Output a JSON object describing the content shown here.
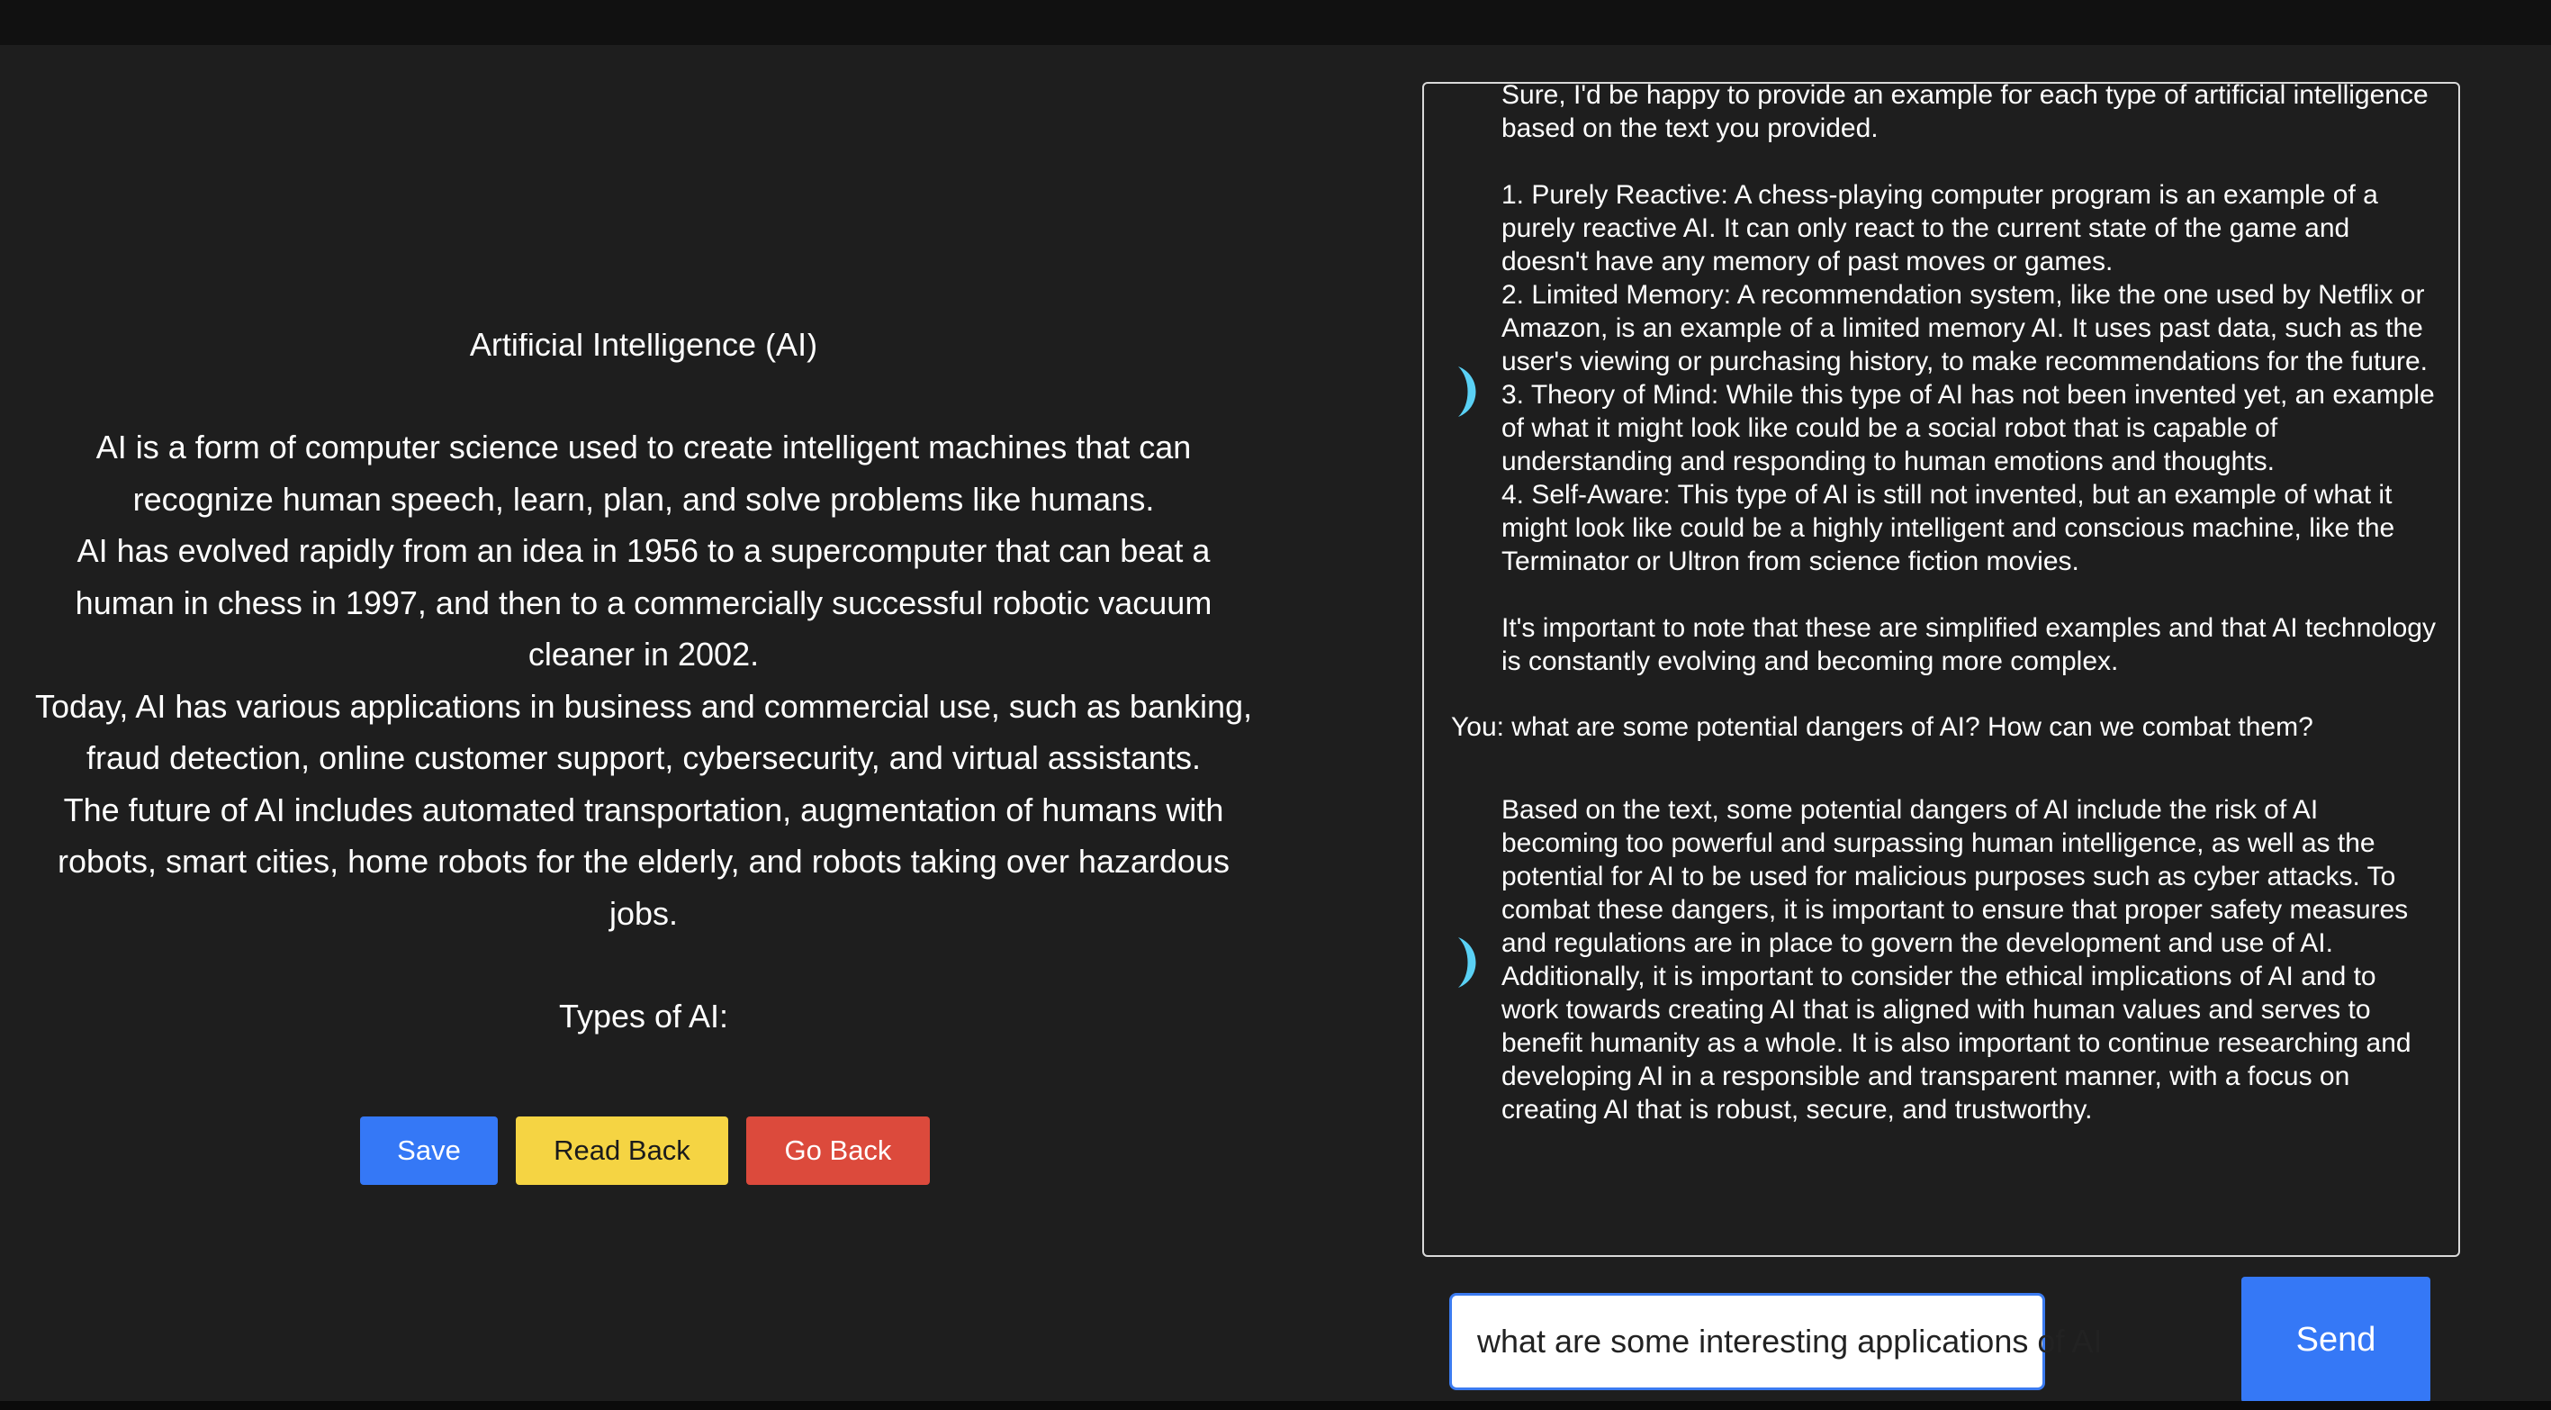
{
  "document": {
    "heading": "Artificial Intelligence (AI)",
    "paragraphs": [
      "AI is a form of computer science used to create intelligent machines that can recognize human speech, learn, plan, and solve problems like humans.",
      "AI has evolved rapidly from an idea in 1956 to a supercomputer that can beat a human in chess in 1997, and then to a commercially successful robotic vacuum cleaner in 2002.",
      "Today, AI has various applications in business and commercial use, such as banking, fraud detection, online customer support, cybersecurity, and virtual assistants.",
      "The future of AI includes automated transportation, augmentation of humans with robots, smart cities, home robots for the elderly, and robots taking over hazardous jobs."
    ],
    "next_heading": "Types of AI:"
  },
  "buttons": {
    "save": "Save",
    "read_back": "Read Back",
    "go_back": "Go Back"
  },
  "chat": {
    "ai_message_1": "Sure, I'd be happy to provide an example for each type of artificial intelligence based on the text you provided.\n\n1. Purely Reactive: A chess-playing computer program is an example of a purely reactive AI. It can only react to the current state of the game and doesn't have any memory of past moves or games.\n2. Limited Memory: A recommendation system, like the one used by Netflix or Amazon, is an example of a limited memory AI. It uses past data, such as the user's viewing or purchasing history, to make recommendations for the future.\n3. Theory of Mind: While this type of AI has not been invented yet, an example of what it might look like could be a social robot that is capable of understanding and responding to human emotions and thoughts.\n4. Self-Aware: This type of AI is still not invented, but an example of what it might look like could be a highly intelligent and conscious machine, like the Terminator or Ultron from science fiction movies.\n\nIt's important to note that these are simplified examples and that AI technology is constantly evolving and becoming more complex.",
    "user_message": "You: what are some potential dangers of AI? How can we combat them?",
    "ai_message_2": "Based on the text, some potential dangers of AI include the risk of AI becoming too powerful and surpassing human intelligence, as well as the potential for AI to be used for malicious purposes such as cyber attacks. To combat these dangers, it is important to ensure that proper safety measures and regulations are in place to govern the development and use of AI. Additionally, it is important to consider the ethical implications of AI and to work towards creating AI that is aligned with human values and serves to benefit humanity as a whole. It is also important to continue researching and developing AI in a responsible and transparent manner, with a focus on creating AI that is robust, secure, and trustworthy.",
    "input_value": "what are some interesting applications of AI",
    "send_label": "Send",
    "ai_icon": "crescent-moon-icon",
    "ai_icon_color": "#5ad1f5"
  },
  "colors": {
    "background": "#1e1e1e",
    "save": "#3578f6",
    "read_back": "#f5d443",
    "go_back": "#dc4a3c",
    "send": "#3578f6",
    "input_border": "#3b7bf0"
  }
}
